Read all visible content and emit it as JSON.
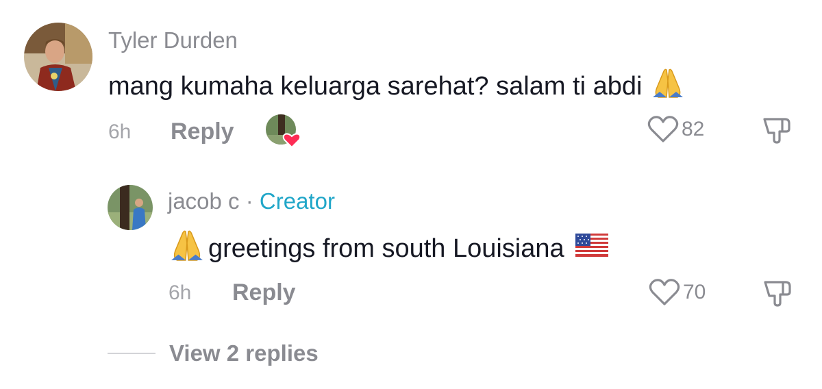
{
  "comment": {
    "author": "Tyler Durden",
    "text": "mang kumaha keluarga sarehat? salam ti abdi",
    "emoji": "folded-hands",
    "time": "6h",
    "reply_label": "Reply",
    "likes": "82"
  },
  "reply": {
    "author": "jacob c",
    "separator": "·",
    "badge": "Creator",
    "text": "greetings from south Louisiana",
    "leading_emoji": "folded-hands",
    "trailing_emoji": "us-flag",
    "time": "6h",
    "reply_label": "Reply",
    "likes": "70"
  },
  "view_replies_label": "View 2 replies",
  "colors": {
    "text": "#161823",
    "muted": "#8a8b91",
    "creator": "#20a6c8",
    "heart": "#fe2c55"
  }
}
